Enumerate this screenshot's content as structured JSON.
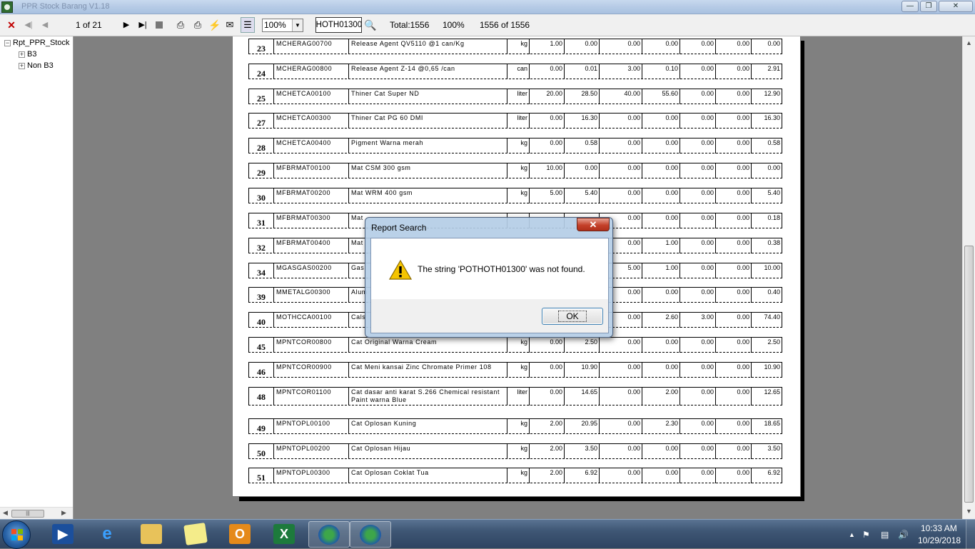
{
  "window": {
    "title": "PPR Stock Barang V1.18"
  },
  "toolbar": {
    "page_indicator": "1 of 21",
    "zoom": "100%",
    "search_value": "POTHOTH01300",
    "total": "Total:1556",
    "percent": "100%",
    "records": "1556 of 1556"
  },
  "tree": {
    "root": "Rpt_PPR_Stock",
    "items": [
      "B3",
      "Non B3"
    ]
  },
  "report": {
    "rows": [
      {
        "no": "23",
        "code": "MCHERAG00700",
        "desc": "Release Agent QV5110 @1 can/Kg",
        "desc2": "",
        "unit": "kg",
        "v1": "1.00",
        "v2": "0.00",
        "v3": "0.00",
        "v4": "0.00",
        "v5": "0.00",
        "v6": "0.00",
        "v7": "0.00"
      },
      {
        "no": "24",
        "code": "MCHERAG00800",
        "desc": "Release Agent Z-14 @0,65 /can",
        "desc2": "",
        "unit": "can",
        "v1": "0.00",
        "v2": "0.01",
        "v3": "3.00",
        "v4": "0.10",
        "v5": "0.00",
        "v6": "0.00",
        "v7": "2.91"
      },
      {
        "no": "25",
        "code": "MCHETCA00100",
        "desc": "Thiner Cat Super ND",
        "desc2": "",
        "unit": "liter",
        "v1": "20.00",
        "v2": "28.50",
        "v3": "40.00",
        "v4": "55.60",
        "v5": "0.00",
        "v6": "0.00",
        "v7": "12.90"
      },
      {
        "no": "27",
        "code": "MCHETCA00300",
        "desc": "Thiner Cat PG 60 DMI",
        "desc2": "",
        "unit": "liter",
        "v1": "0.00",
        "v2": "16.30",
        "v3": "0.00",
        "v4": "0.00",
        "v5": "0.00",
        "v6": "0.00",
        "v7": "16.30"
      },
      {
        "no": "28",
        "code": "MCHETCA00400",
        "desc": "Pigment Warna merah",
        "desc2": "",
        "unit": "kg",
        "v1": "0.00",
        "v2": "0.58",
        "v3": "0.00",
        "v4": "0.00",
        "v5": "0.00",
        "v6": "0.00",
        "v7": "0.58"
      },
      {
        "no": "29",
        "code": "MFBRMAT00100",
        "desc": "Mat CSM 300 gsm",
        "desc2": "",
        "unit": "kg",
        "v1": "10.00",
        "v2": "0.00",
        "v3": "0.00",
        "v4": "0.00",
        "v5": "0.00",
        "v6": "0.00",
        "v7": "0.00"
      },
      {
        "no": "30",
        "code": "MFBRMAT00200",
        "desc": "Mat WRM 400 gsm",
        "desc2": "",
        "unit": "kg",
        "v1": "5.00",
        "v2": "5.40",
        "v3": "0.00",
        "v4": "0.00",
        "v5": "0.00",
        "v6": "0.00",
        "v7": "5.40"
      },
      {
        "no": "31",
        "code": "MFBRMAT00300",
        "desc": "Mat",
        "desc2": "",
        "unit": "",
        "v1": "",
        "v2": "",
        "v3": "0.00",
        "v4": "0.00",
        "v5": "0.00",
        "v6": "0.00",
        "v7": "0.18"
      },
      {
        "no": "32",
        "code": "MFBRMAT00400",
        "desc": "Mat",
        "desc2": "",
        "unit": "",
        "v1": "",
        "v2": "",
        "v3": "0.00",
        "v4": "1.00",
        "v5": "0.00",
        "v6": "0.00",
        "v7": "0.38"
      },
      {
        "no": "34",
        "code": "MGASGAS00200",
        "desc": "Gas",
        "desc2": "",
        "unit": "",
        "v1": "",
        "v2": "",
        "v3": "5.00",
        "v4": "1.00",
        "v5": "0.00",
        "v6": "0.00",
        "v7": "10.00"
      },
      {
        "no": "39",
        "code": "MMETALG00300",
        "desc": "Alum",
        "desc2": "",
        "unit": "",
        "v1": "",
        "v2": "",
        "v3": "0.00",
        "v4": "0.00",
        "v5": "0.00",
        "v6": "0.00",
        "v7": "0.40"
      },
      {
        "no": "40",
        "code": "MOTHCCA00100",
        "desc": "Cals",
        "desc2": "",
        "unit": "",
        "v1": "",
        "v2": "",
        "v3": "0.00",
        "v4": "2.60",
        "v5": "3.00",
        "v6": "0.00",
        "v7": "74.40"
      },
      {
        "no": "45",
        "code": "MPNTCOR00800",
        "desc": "Cat Original Warna Cream",
        "desc2": "",
        "unit": "kg",
        "v1": "0.00",
        "v2": "2.50",
        "v3": "0.00",
        "v4": "0.00",
        "v5": "0.00",
        "v6": "0.00",
        "v7": "2.50"
      },
      {
        "no": "46",
        "code": "MPNTCOR00900",
        "desc": "Cat Meni kansai Zinc Chromate Primer 108",
        "desc2": "",
        "unit": "kg",
        "v1": "0.00",
        "v2": "10.90",
        "v3": "0.00",
        "v4": "0.00",
        "v5": "0.00",
        "v6": "0.00",
        "v7": "10.90"
      },
      {
        "no": "48",
        "code": "MPNTCOR01100",
        "desc": "Cat dasar anti karat S.266 Chemical resistant",
        "desc2": "Paint warna Blue",
        "unit": "liter",
        "v1": "0.00",
        "v2": "14.65",
        "v3": "0.00",
        "v4": "2.00",
        "v5": "0.00",
        "v6": "0.00",
        "v7": "12.65"
      },
      {
        "no": "49",
        "code": "MPNTOPL00100",
        "desc": "Cat Oplosan Kuning",
        "desc2": "",
        "unit": "kg",
        "v1": "2.00",
        "v2": "20.95",
        "v3": "0.00",
        "v4": "2.30",
        "v5": "0.00",
        "v6": "0.00",
        "v7": "18.65"
      },
      {
        "no": "50",
        "code": "MPNTOPL00200",
        "desc": "Cat Oplosan Hijau",
        "desc2": "",
        "unit": "kg",
        "v1": "2.00",
        "v2": "3.50",
        "v3": "0.00",
        "v4": "0.00",
        "v5": "0.00",
        "v6": "0.00",
        "v7": "3.50"
      },
      {
        "no": "51",
        "code": "MPNTOPL00300",
        "desc": "Cat Oplosan Coklat Tua",
        "desc2": "",
        "unit": "kg",
        "v1": "2.00",
        "v2": "6.92",
        "v3": "0.00",
        "v4": "0.00",
        "v5": "0.00",
        "v6": "0.00",
        "v7": "6.92"
      }
    ]
  },
  "dialog": {
    "title": "Report Search",
    "message": "The string 'POTHOTH01300' was not found.",
    "ok_label": "OK",
    "icon": "warning-icon"
  },
  "taskbar": {
    "time": "10:33 AM",
    "date": "10/29/2018"
  },
  "colors": {
    "dialog_frame": "#b4cde6",
    "taskbar": "#3e5674",
    "report_bg": "#808080"
  }
}
